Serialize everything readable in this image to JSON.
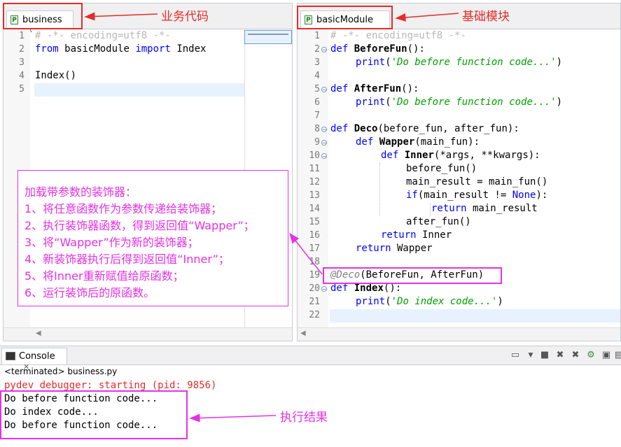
{
  "left_editor": {
    "tab": "business",
    "lines": [
      {
        "n": "1",
        "text": "# -*- encoding=utf8 -*-"
      },
      {
        "n": "2",
        "text": "from basicModule import Index"
      },
      {
        "n": "3",
        "text": ""
      },
      {
        "n": "4",
        "text": "Index()"
      },
      {
        "n": "5",
        "text": ""
      }
    ]
  },
  "right_editor": {
    "tab": "basicModule",
    "line_numbers": [
      "1",
      "2",
      "3",
      "4",
      "5",
      "6",
      "7",
      "8",
      "9",
      "10",
      "11",
      "12",
      "13",
      "14",
      "15",
      "16",
      "17",
      "18",
      "19",
      "20",
      "21",
      "22"
    ],
    "code": {
      "l1": "# -*- encoding=utf8 -*-",
      "l2_kw": "def",
      "l2_fn": "BeforeFun",
      "l2_rest": "():",
      "l3_kw": "print",
      "l3_str": "'Do before function code...'",
      "l5_kw": "def",
      "l5_fn": "AfterFun",
      "l5_rest": "():",
      "l6_kw": "print",
      "l6_str": "'Do before function code...'",
      "l8_kw": "def",
      "l8_fn": "Deco",
      "l8_rest": "(before_fun, after_fun):",
      "l9_kw": "def",
      "l9_fn": "Wapper",
      "l9_rest": "(main_fun):",
      "l10_kw": "def",
      "l10_fn": "Inner",
      "l10_rest": "(*args, **kwargs):",
      "l11": "before_fun()",
      "l12": "main_result = main_fun()",
      "l13_kw": "if",
      "l13_a": "(main_result != ",
      "l13_none": "None",
      "l13_b": "):",
      "l14_kw": "return",
      "l14_rest": " main_result",
      "l15": "after_fun()",
      "l16_kw": "return",
      "l16_rest": " Inner",
      "l17_kw": "return",
      "l17_rest": " Wapper",
      "l19_dec": "@Deco",
      "l19_rest": "(BeforeFun, AfterFun)",
      "l20_kw": "def",
      "l20_fn": "Index",
      "l20_rest": "():",
      "l21_kw": "print",
      "l21_str": "'Do index code...'"
    }
  },
  "console": {
    "tab": "Console",
    "status": "<terminated> business.py",
    "output": [
      "pydev debugger: starting (pid: 9856)",
      "Do before function code...",
      "Do index code...",
      "Do before function code..."
    ]
  },
  "annotations": {
    "business_label": "业务代码",
    "basic_label": "基础模块",
    "result_label": "执行结果",
    "note_lines": [
      "加载带参数的装饰器：",
      "1、将任意函数作为参数传递给装饰器；",
      "2、执行装饰器函数，得到返回值“Wapper”；",
      "3、将“Wapper”作为新的装饰器；",
      "4、新装饰器执行后得到返回值“Inner”；",
      "5、将Inner重新赋值给原函数；",
      "6、运行装饰后的原函数。"
    ]
  },
  "colors": {
    "keyword": "#0000ff",
    "string": "#00a000",
    "comment": "#b8b8b8",
    "annotation_red": "#e52b2b",
    "annotation_magenta": "#e531e5",
    "error_text": "#e52b2b"
  }
}
